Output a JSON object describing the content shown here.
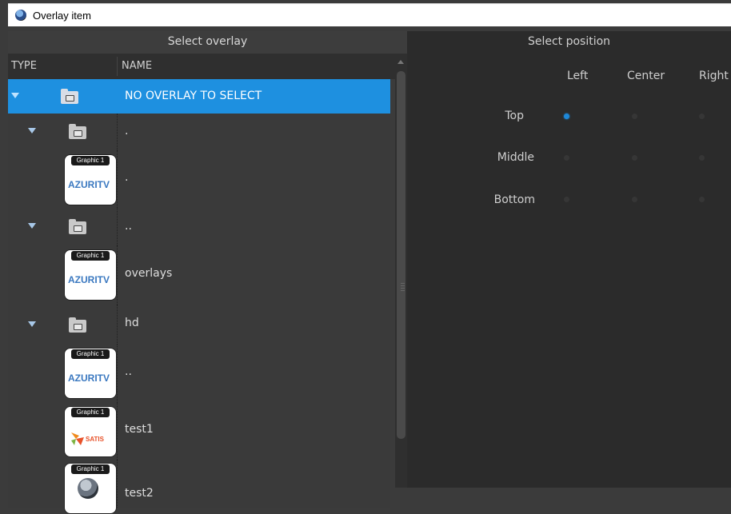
{
  "window": {
    "title": "Overlay item",
    "app_icon": "globe-app-icon"
  },
  "overlay_panel": {
    "header": "Select overlay",
    "columns": {
      "type": "TYPE",
      "name": "NAME"
    },
    "rows": [
      {
        "kind": "folder",
        "expanded": true,
        "name": "NO OVERLAY TO SELECT",
        "selected": true
      },
      {
        "kind": "folder",
        "expanded": true,
        "name": "."
      },
      {
        "kind": "graphic",
        "badge": "Graphic 1",
        "logo": "AZURITV",
        "name": "."
      },
      {
        "kind": "folder",
        "expanded": true,
        "name": ".."
      },
      {
        "kind": "graphic",
        "badge": "Graphic 1",
        "logo": "AZURITV",
        "name": "overlays"
      },
      {
        "kind": "folder",
        "expanded": true,
        "name": "hd"
      },
      {
        "kind": "graphic",
        "badge": "Graphic 1",
        "logo": "AZURITV",
        "name": ".."
      },
      {
        "kind": "graphic",
        "badge": "Graphic 1",
        "logo": "SATIS",
        "name": "test1"
      },
      {
        "kind": "graphic",
        "badge": "Graphic 1",
        "logo": "globe",
        "name": "test2"
      }
    ]
  },
  "position_panel": {
    "header": "Select position",
    "columns": [
      "Left",
      "Center",
      "Right"
    ],
    "rows": [
      "Top",
      "Middle",
      "Bottom"
    ],
    "selected": {
      "row": "Top",
      "column": "Left"
    }
  },
  "colors": {
    "selection": "#1e90e0",
    "background": "#3a3a3a",
    "radio_checked": "#1e88d8"
  }
}
